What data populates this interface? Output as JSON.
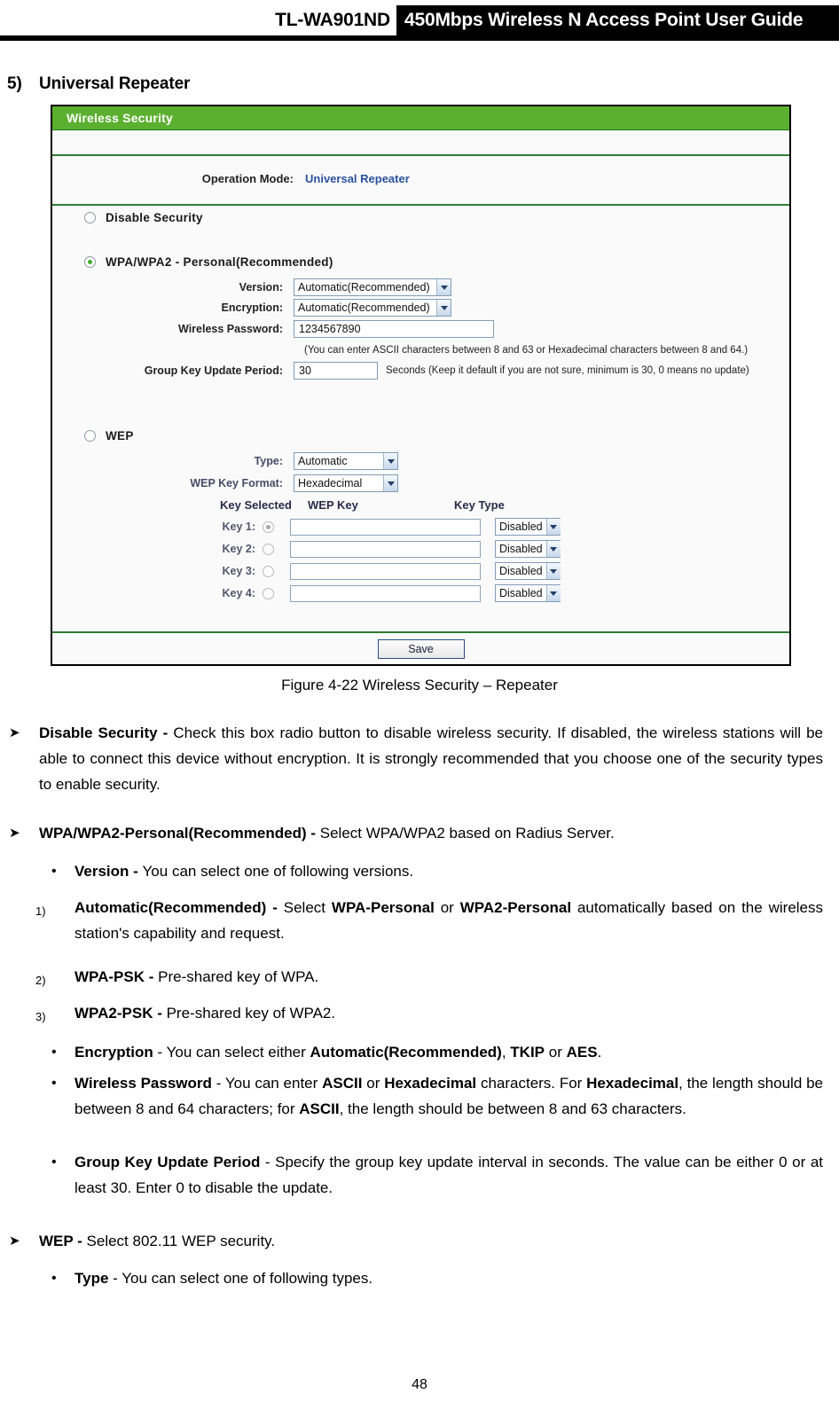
{
  "header": {
    "model": "TL-WA901ND",
    "title": "450Mbps Wireless N Access Point User Guide"
  },
  "section": {
    "number": "5)",
    "title": "Universal Repeater"
  },
  "panel": {
    "titlebar": "Wireless Security",
    "operation_mode_label": "Operation Mode:",
    "operation_mode_value": "Universal Repeater",
    "accent_green": "#5cb030",
    "accent_border_green": "#2e7d32",
    "link_blue": "#2a52a0",
    "options": {
      "disable_security": {
        "label": "Disable Security",
        "selected": false
      },
      "wpa": {
        "label": "WPA/WPA2 - Personal(Recommended)",
        "selected": true
      },
      "wep": {
        "label": "WEP",
        "selected": false
      }
    },
    "wpa_fields": {
      "version_label": "Version:",
      "version_value": "Automatic(Recommended)",
      "encryption_label": "Encryption:",
      "encryption_value": "Automatic(Recommended)",
      "password_label": "Wireless Password:",
      "password_value": "1234567890",
      "password_hint": "(You can enter ASCII characters between 8 and 63 or Hexadecimal characters between 8 and 64.)",
      "group_key_label": "Group Key Update Period:",
      "group_key_value": "30",
      "group_key_unit": "Seconds (Keep it default if you are not sure, minimum is 30, 0 means no update)"
    },
    "wep_fields": {
      "type_label": "Type:",
      "type_value": "Automatic",
      "format_label": "WEP Key Format:",
      "format_value": "Hexadecimal",
      "col_key_selected": "Key Selected",
      "col_wep_key": "WEP Key",
      "col_key_type": "Key Type",
      "keys": [
        {
          "label": "Key 1:",
          "selected": true,
          "value": "",
          "type": "Disabled"
        },
        {
          "label": "Key 2:",
          "selected": false,
          "value": "",
          "type": "Disabled"
        },
        {
          "label": "Key 3:",
          "selected": false,
          "value": "",
          "type": "Disabled"
        },
        {
          "label": "Key 4:",
          "selected": false,
          "value": "",
          "type": "Disabled"
        }
      ]
    },
    "save_label": "Save"
  },
  "figure_caption": "Figure 4-22 Wireless Security – Repeater",
  "body": {
    "disable_security": {
      "marker": "➤",
      "term": "Disable Security - ",
      "text": "Check this box radio button to disable wireless security. If disabled, the wireless stations will be able to connect this device without encryption. It is strongly recommended that you choose one of the security types to enable security."
    },
    "wpa_personal": {
      "marker": "➤",
      "term": "WPA/WPA2-Personal(Recommended) - ",
      "text": "Select WPA/WPA2 based on Radius Server."
    },
    "version": {
      "marker": "•",
      "term": "Version - ",
      "text": "You can select one of following versions."
    },
    "automatic": {
      "marker": "1)",
      "term": "Automatic(Recommended) - ",
      "text_a": "Select ",
      "bold_a": "WPA-Personal",
      "text_b": " or ",
      "bold_b": "WPA2-Personal",
      "text_c": " automatically based on the wireless station's capability and request."
    },
    "wpa_psk": {
      "marker": "2)",
      "term": "WPA-PSK - ",
      "text": "Pre-shared key of WPA."
    },
    "wpa2_psk": {
      "marker": "3)",
      "term": "WPA2-PSK - ",
      "text": "Pre-shared key of WPA2."
    },
    "encryption": {
      "marker": "•",
      "term": "Encryption",
      "text_a": " - You can select either ",
      "bold_a": "Automatic(Recommended)",
      "text_b": ", ",
      "bold_b": "TKIP",
      "text_c": " or ",
      "bold_c": "AES",
      "text_d": "."
    },
    "wireless_password": {
      "marker": "•",
      "term": "Wireless Password",
      "text_a": " - You can enter ",
      "bold_a": "ASCII",
      "text_b": " or ",
      "bold_b": "Hexadecimal",
      "text_c": " characters. For ",
      "bold_c": "Hexadecimal",
      "text_d": ", the length should be between 8 and 64 characters; for ",
      "bold_d": "ASCII",
      "text_e": ", the length should be between 8 and 63 characters."
    },
    "group_key_update": {
      "marker": "•",
      "term": "Group Key Update Period",
      "text": " - Specify the group key update interval in seconds. The value can be either 0 or at least 30. Enter 0 to disable the update."
    },
    "wep": {
      "marker": "➤",
      "term": "WEP - ",
      "text": "Select 802.11 WEP security."
    },
    "type": {
      "marker": "•",
      "term": "Type",
      "text": " - You can select one of following types."
    }
  },
  "page_number": "48"
}
